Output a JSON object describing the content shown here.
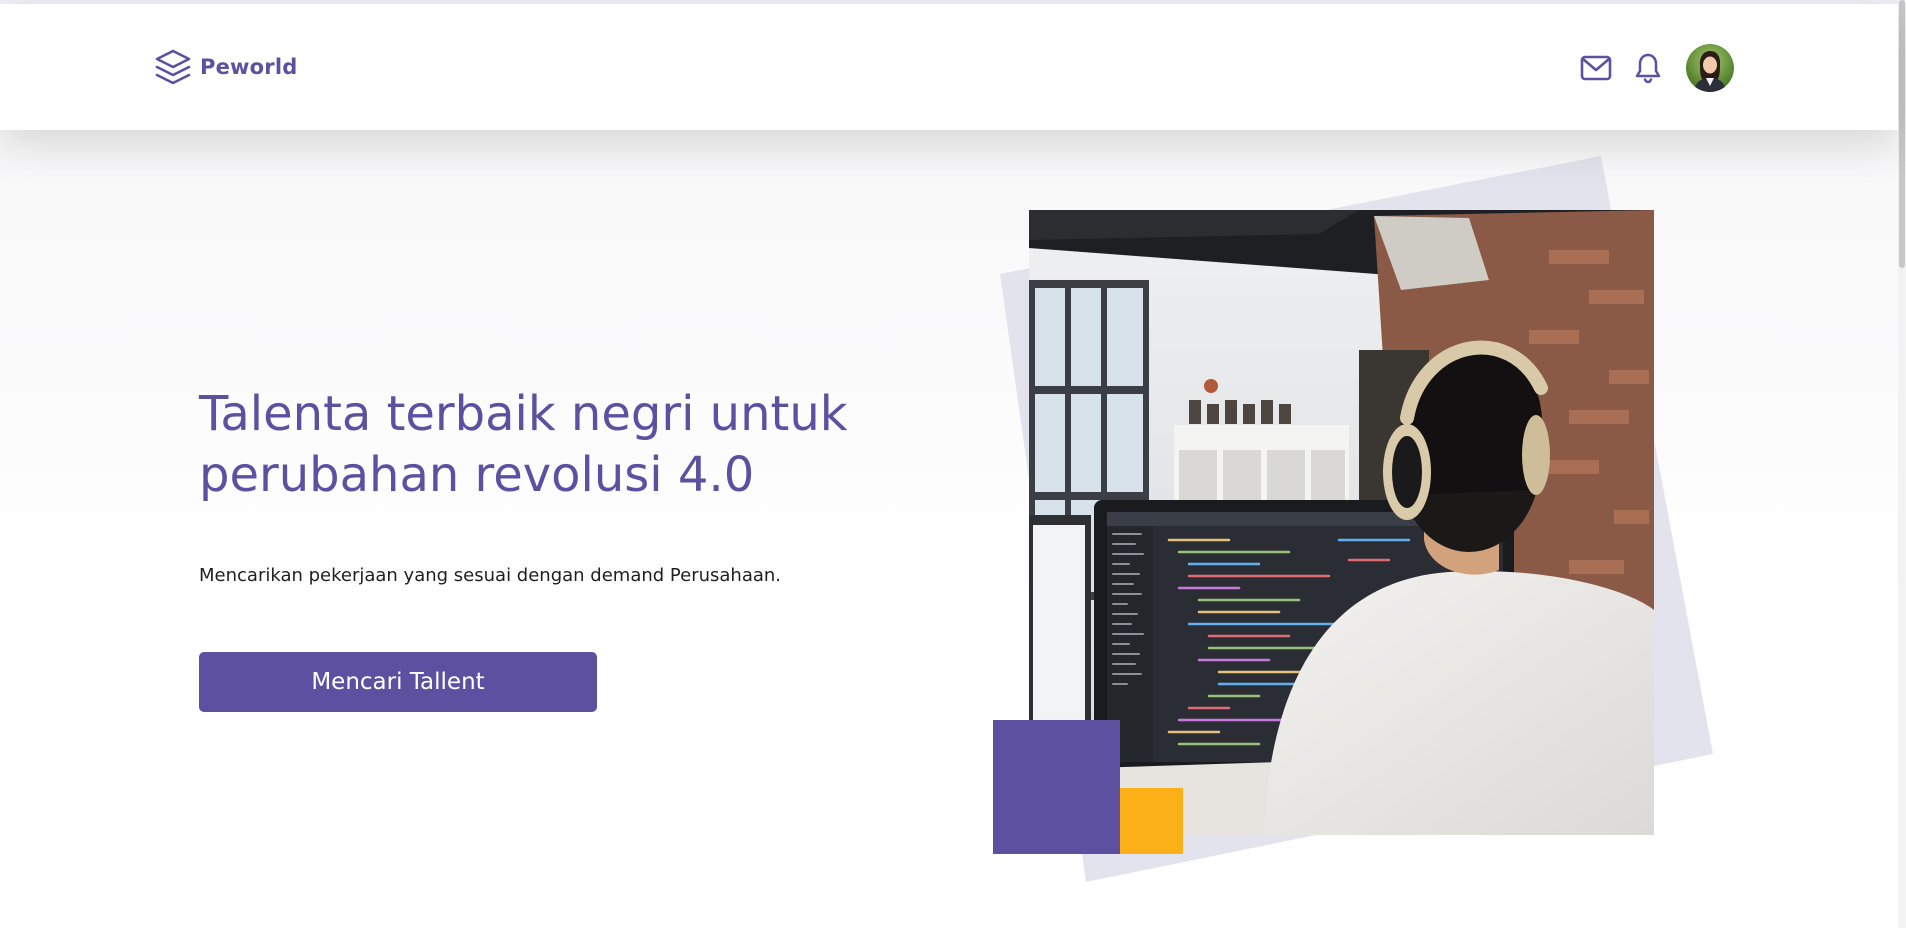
{
  "brand": {
    "name": "Peworld",
    "logo_icon": "layers-icon",
    "color": "#5e50a1"
  },
  "navbar": {
    "mail_icon": "mail-icon",
    "notification_icon": "bell-icon",
    "avatar_icon": "user-avatar"
  },
  "hero": {
    "title": "Talenta terbaik negri untuk perubahan revolusi 4.0",
    "subtitle": "Mencarikan pekerjaan yang sesuai dengan demand Perusahaan.",
    "cta_label": "Mencari Tallent",
    "image": "developer-with-headphones-coding-photo"
  },
  "colors": {
    "primary": "#5e50a1",
    "accent_yellow": "#fbb017",
    "shape_gray": "#e3e3ee"
  }
}
